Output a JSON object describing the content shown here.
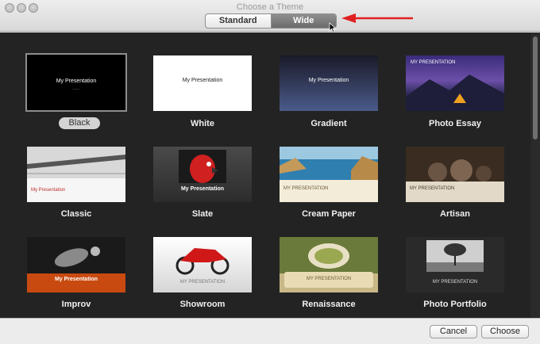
{
  "window": {
    "title": "Choose a Theme"
  },
  "segmented": {
    "standard": "Standard",
    "wide": "Wide",
    "selected": "Wide"
  },
  "themes": [
    {
      "name": "Black",
      "slide_title": "My Presentation",
      "selected": true
    },
    {
      "name": "White",
      "slide_title": "My Presentation"
    },
    {
      "name": "Gradient",
      "slide_title": "My Presentation"
    },
    {
      "name": "Photo Essay",
      "slide_title": "MY PRESENTATION"
    },
    {
      "name": "Classic",
      "slide_title": "My Presentation"
    },
    {
      "name": "Slate",
      "slide_title": "My Presentation"
    },
    {
      "name": "Cream Paper",
      "slide_title": "MY PRESENTATION"
    },
    {
      "name": "Artisan",
      "slide_title": "MY PRESENTATION"
    },
    {
      "name": "Improv",
      "slide_title": "My Presentation"
    },
    {
      "name": "Showroom",
      "slide_title": "MY PRESENTATION"
    },
    {
      "name": "Renaissance",
      "slide_title": "MY PRESENTATION"
    },
    {
      "name": "Photo Portfolio",
      "slide_title": "MY PRESENTATION"
    }
  ],
  "buttons": {
    "cancel": "Cancel",
    "choose": "Choose"
  },
  "colors": {
    "accent_arrow": "#e02020",
    "selected_segment": "#7a7a7a",
    "content_bg": "#232323"
  }
}
